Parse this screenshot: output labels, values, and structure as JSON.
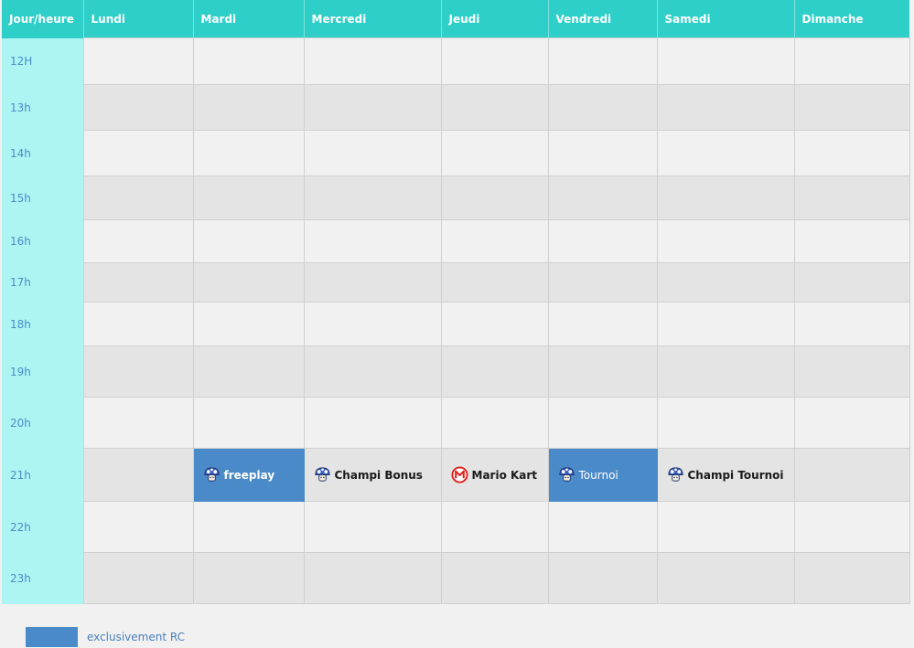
{
  "header": {
    "corner": "Jour/heure",
    "days": [
      "Lundi",
      "Mardi",
      "Mercredi",
      "Jeudi",
      "Vendredi",
      "Samedi",
      "Dimanche"
    ]
  },
  "hours": [
    "12H",
    "13h",
    "14h",
    "15h",
    "16h",
    "17h",
    "18h",
    "19h",
    "20h",
    "21h",
    "22h",
    "23h"
  ],
  "events": {
    "mardi": {
      "label": "freeplay",
      "icon": "mushroom-icon",
      "exclusive_rc": true
    },
    "mercredi": {
      "label": "Champi Bonus",
      "icon": "mushroom-icon",
      "exclusive_rc": false
    },
    "jeudi": {
      "label": "Mario Kart",
      "icon": "mario-kart-logo-icon",
      "exclusive_rc": false
    },
    "vendredi": {
      "label": "Tournoi",
      "icon": "mushroom-icon",
      "exclusive_rc": true
    },
    "samedi": {
      "label": "Champi Tournoi",
      "icon": "mushroom-icon",
      "exclusive_rc": false
    }
  },
  "legend": {
    "label": "exclusivement RC",
    "color": "#4a8ac8"
  },
  "colors": {
    "header": "#2ecfc8",
    "hour_column": "#adf5f2",
    "row_light": "#f1f1f1",
    "row_dark": "#e4e4e4",
    "rc_highlight": "#4a8ac8"
  }
}
